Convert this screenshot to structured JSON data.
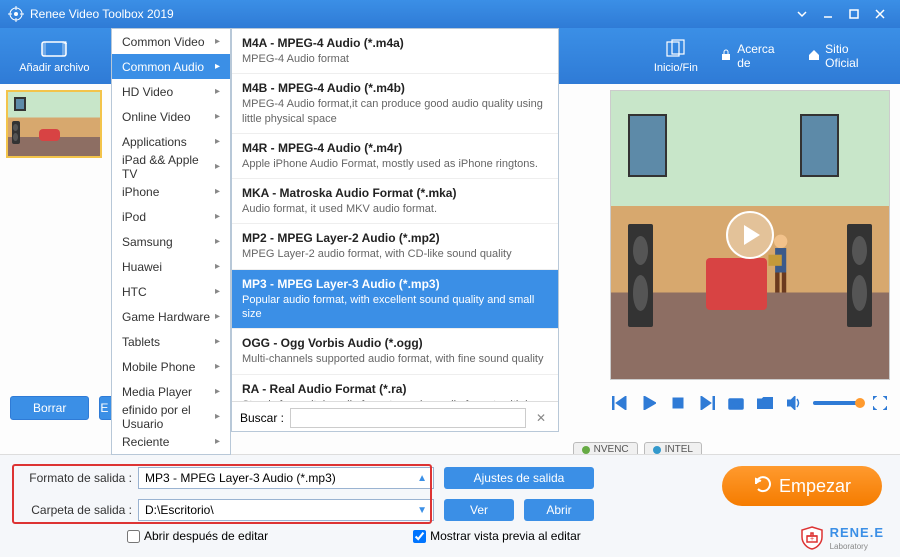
{
  "app_title": "Renee Video Toolbox 2019",
  "toolbar": {
    "add_file": "Añadir archivo",
    "start_end": "Inicio/Fin",
    "about": "Acerca de",
    "official_site": "Sitio Oficial"
  },
  "categories": [
    "Common Video",
    "Common Audio",
    "HD Video",
    "Online Video",
    "Applications",
    "iPad && Apple TV",
    "iPhone",
    "iPod",
    "Samsung",
    "Huawei",
    "HTC",
    "Game Hardware",
    "Tablets",
    "Mobile Phone",
    "Media Player",
    "efinido por el Usuario",
    "Reciente"
  ],
  "category_selected_index": 1,
  "formats": [
    {
      "title": "M4A - MPEG-4 Audio (*.m4a)",
      "desc": "MPEG-4 Audio format"
    },
    {
      "title": "M4B - MPEG-4 Audio (*.m4b)",
      "desc": "MPEG-4 Audio format,it can produce good audio quality using little physical space"
    },
    {
      "title": "M4R - MPEG-4 Audio (*.m4r)",
      "desc": "Apple iPhone Audio Format, mostly used as iPhone ringtons."
    },
    {
      "title": "MKA - Matroska Audio Format (*.mka)",
      "desc": "Audio format, it used MKV audio format."
    },
    {
      "title": "MP2 - MPEG Layer-2 Audio (*.mp2)",
      "desc": "MPEG Layer-2 audio format, with CD-like sound quality"
    },
    {
      "title": "MP3 - MPEG Layer-3 Audio (*.mp3)",
      "desc": "Popular audio format, with excellent sound quality and small size"
    },
    {
      "title": "OGG - Ogg Vorbis Audio (*.ogg)",
      "desc": "Multi-channels supported audio format, with fine sound quality"
    },
    {
      "title": "RA - Real Audio Format (*.ra)",
      "desc": "Stands for realtek audio format,popular audio format, with low bitrate and fine sound quality"
    }
  ],
  "format_selected_index": 5,
  "search_label": "Buscar :",
  "list_buttons": {
    "delete": "Borrar",
    "empty": "E"
  },
  "bottom": {
    "format_label": "Formato de salida :",
    "format_value": "MP3 - MPEG Layer-3 Audio (*.mp3)",
    "folder_label": "Carpeta de salida :",
    "folder_value": "D:\\Escritorio\\",
    "output_settings": "Ajustes de salida",
    "view": "Ver",
    "open": "Abrir",
    "open_after": "Abrir después de editar",
    "show_preview": "Mostrar vista previa al editar"
  },
  "hw": {
    "nvenc": "NVENC",
    "intel": "INTEL"
  },
  "start": "Empezar",
  "brand": {
    "name": "RENE.E",
    "sub": "Laboratory"
  }
}
